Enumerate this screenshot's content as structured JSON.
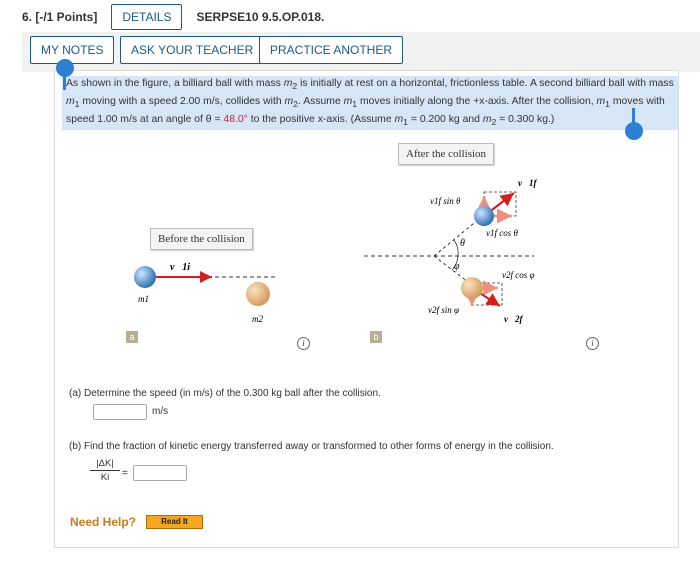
{
  "header": {
    "question_number": "6. [-/1 Points]",
    "details_label": "DETAILS",
    "code": "SERPSE10 9.5.OP.018."
  },
  "toolbar": {
    "notes_label": "MY NOTES",
    "ask_label": "ASK YOUR TEACHER",
    "practice_label": "PRACTICE ANOTHER"
  },
  "problem": {
    "p1": "As shown in the figure, a billiard ball with mass ",
    "m2a": "m",
    "p2": " is initially at rest on a horizontal, frictionless table. A second billiard ball with mass ",
    "p3": " moving with a speed 2.00 m/s, collides with ",
    "p4": ". Assume ",
    "p5": " moves initially along the +x-axis. After the collision, ",
    "p6": " moves with speed 1.00 m/s at an angle of θ = ",
    "angle": "48.0°",
    "p7": " to the positive x-axis. (Assume ",
    "p8": " = 0.200 kg and ",
    "p9": " = 0.300 kg.)"
  },
  "figure": {
    "before_label": "Before the collision",
    "after_label": "After the collision",
    "tag_a": "a",
    "tag_b": "b",
    "info_glyph": "i",
    "v1i": "v⃗1i",
    "m1": "m1",
    "m2": "m2",
    "v1f_sin": "v1f sin θ",
    "v1f_cos": "v1f cos θ",
    "v2f_cos": "v2f cos φ",
    "v2f_sin": "v2f sin φ",
    "v1f": "v⃗1f",
    "v2f": "v⃗2f",
    "theta": "θ",
    "phi": "φ"
  },
  "parts": {
    "a_text": "(a)  Determine the speed (in m/s) of the 0.300 kg ball after the collision.",
    "a_unit": "m/s",
    "b_text": "(b)  Find the fraction of kinetic energy transferred away or transformed to other forms of energy in the collision.",
    "b_num": "|ΔK|",
    "b_den": "Ki",
    "b_eq": "="
  },
  "help": {
    "need_help": "Need Help?",
    "read_it": "Read It"
  },
  "colors": {
    "accent": "#1d5a8c",
    "highlight": "#d7e6f7",
    "angle_red": "#d0202a",
    "help_orange": "#c87c1c"
  }
}
